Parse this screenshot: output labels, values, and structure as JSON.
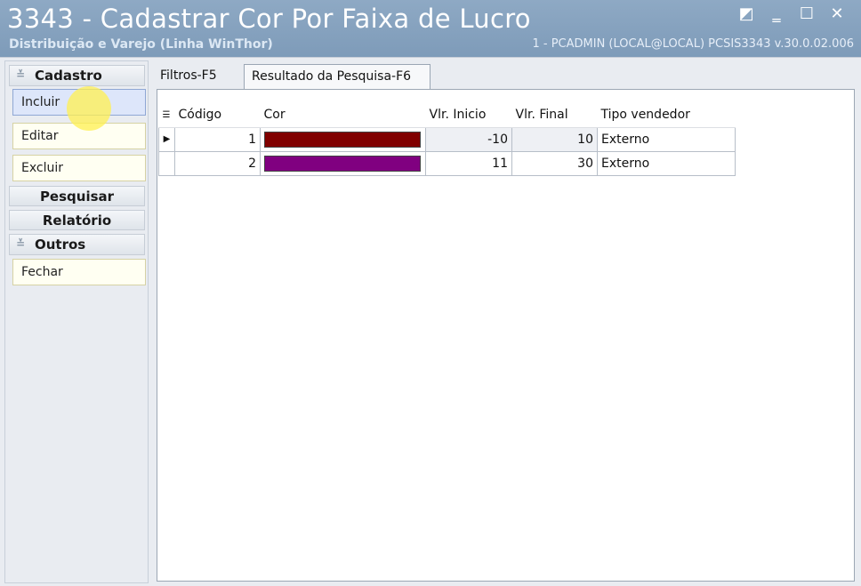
{
  "window": {
    "title": "3343 - Cadastrar Cor Por Faixa de Lucro",
    "subtitle": "Distribuição e Varejo (Linha WinThor)",
    "info": "1 - PCADMIN (LOCAL@LOCAL)   PCSIS3343  v.30.0.02.006",
    "controls": [
      "◩",
      "‗",
      "☐",
      "✕"
    ]
  },
  "sidebar": {
    "cadastro_label": "Cadastro",
    "incluir_label": "Incluir",
    "editar_label": "Editar",
    "excluir_label": "Excluir",
    "pesquisar_label": "Pesquisar",
    "relatorio_label": "Relatório",
    "outros_label": "Outros",
    "fechar_label": "Fechar"
  },
  "tabs": {
    "filtros": "Filtros-F5",
    "resultado": "Resultado da Pesquisa-F6"
  },
  "grid": {
    "columns": [
      "Código",
      "Cor",
      "Vlr. Inicio",
      "Vlr. Final",
      "Tipo vendedor"
    ],
    "rows": [
      {
        "indicator": "▶",
        "codigo": "1",
        "color": "#800000",
        "inicio": "-10",
        "final": "10",
        "tipo": "Externo"
      },
      {
        "indicator": "",
        "codigo": "2",
        "color": "#800080",
        "inicio": "11",
        "final": "30",
        "tipo": "Externo"
      }
    ]
  }
}
